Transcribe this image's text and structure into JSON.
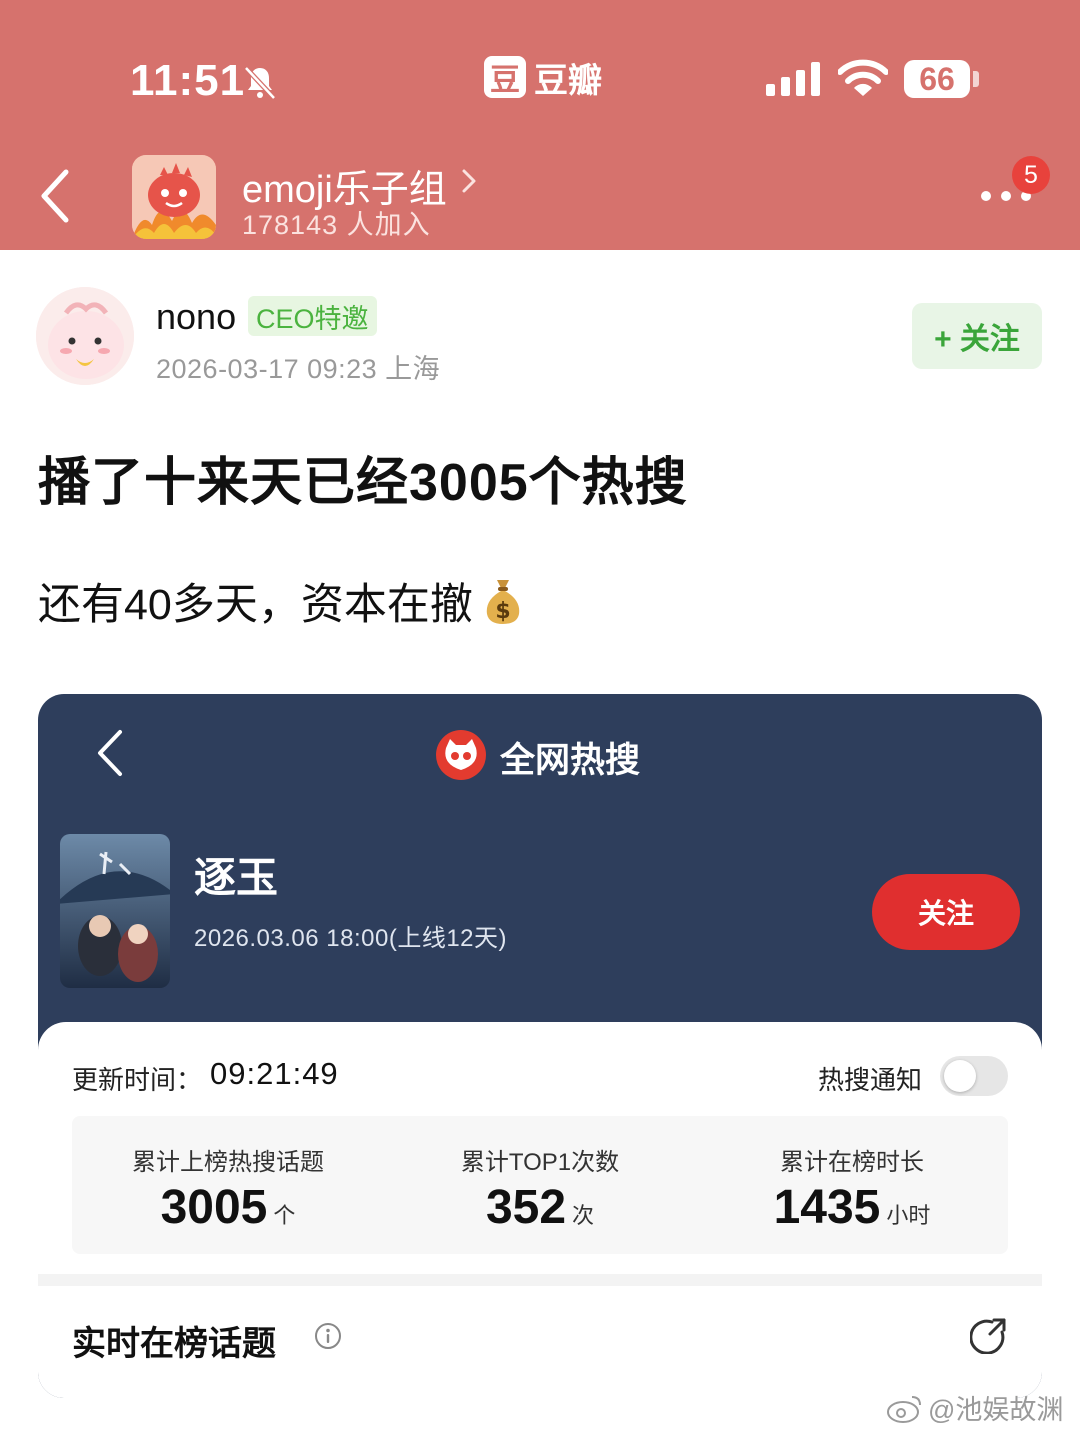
{
  "status_bar": {
    "time": "11:51",
    "battery": "66"
  },
  "app": {
    "logo_glyph": "豆",
    "name": "豆瓣"
  },
  "group": {
    "name": "emoji乐子组",
    "members": "178143 人加入",
    "notification_count": "5"
  },
  "post": {
    "author": "nono",
    "author_badge": "CEO特邀",
    "meta": "2026-03-17 09:23  上海",
    "follow_label": "+ 关注",
    "title": "播了十来天已经3005个热搜",
    "body": "还有40多天，资本在撤"
  },
  "card": {
    "title": "全网热搜",
    "show_title": "逐玉",
    "show_date": "2026.03.06 18:00(上线12天)",
    "follow_label": "关注",
    "update_label": "更新时间：",
    "update_time": "09:21:49",
    "notify_label": "热搜通知",
    "notify_enabled": false,
    "stats": [
      {
        "label": "累计上榜热搜话题",
        "value": "3005",
        "unit": "个"
      },
      {
        "label": "累计TOP1次数",
        "value": "352",
        "unit": "次"
      },
      {
        "label": "累计在榜时长",
        "value": "1435",
        "unit": "小时"
      }
    ],
    "topics_title": "实时在榜话题"
  },
  "watermark": "@池娱故渊",
  "icons": {
    "back": "chevron-left-icon",
    "mute": "bell-slash-icon",
    "signal": "signal-icon",
    "wifi": "wifi-icon",
    "more": "more-dots-icon",
    "moneybag": "money-bag-icon",
    "info": "info-icon",
    "share": "share-icon"
  },
  "colors": {
    "header": "#d6726d",
    "card_bg": "#2e3e5c",
    "follow_green": "#3aa53a",
    "card_follow_red": "#e02f2f"
  }
}
